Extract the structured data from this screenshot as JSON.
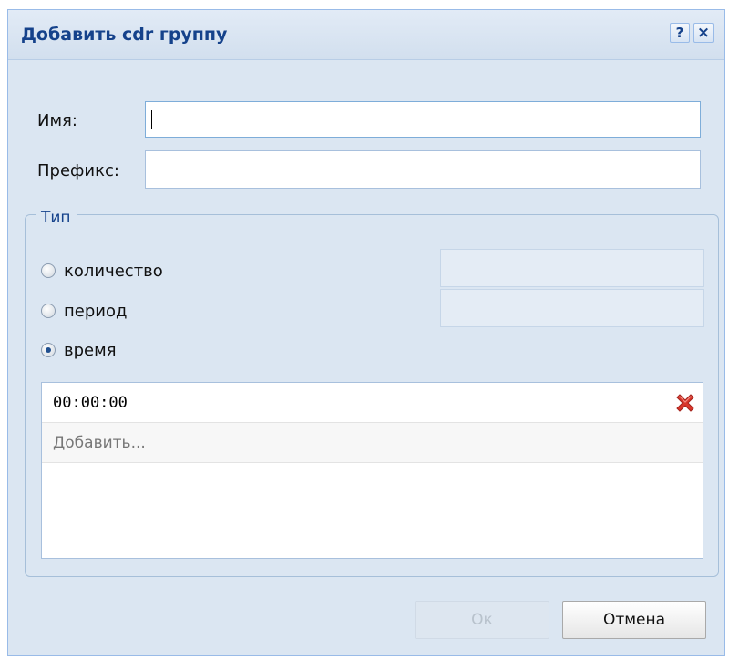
{
  "dialog": {
    "title": "Добавить cdr группу",
    "help_icon": "?",
    "close_icon": "×"
  },
  "form": {
    "name_label": "Имя:",
    "name_value": "",
    "prefix_label": "Префикс:",
    "prefix_value": ""
  },
  "type_group": {
    "legend": "Тип",
    "options": [
      {
        "label": "количество",
        "checked": false
      },
      {
        "label": "период",
        "checked": false
      },
      {
        "label": "время",
        "checked": true
      }
    ]
  },
  "times": {
    "items": [
      "00:00:00"
    ],
    "add_placeholder": "Добавить..."
  },
  "buttons": {
    "ok": "Ок",
    "cancel": "Отмена"
  },
  "colors": {
    "title": "#15428b",
    "panel": "#dbe6f2",
    "delete_icon": "#d9362b"
  }
}
